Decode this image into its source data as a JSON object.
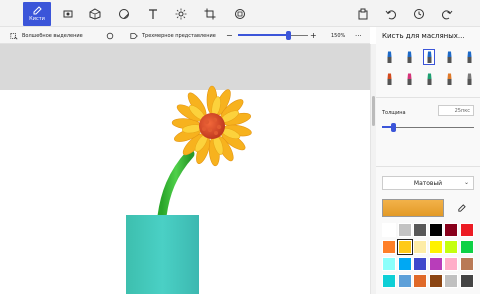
{
  "toolbar": {
    "brushes_label": "Кисти",
    "tools": [
      {
        "name": "2d-shapes-icon"
      },
      {
        "name": "3d-shapes-icon"
      },
      {
        "name": "stickers-icon"
      },
      {
        "name": "text-icon"
      },
      {
        "name": "effects-icon"
      },
      {
        "name": "canvas-icon"
      },
      {
        "name": "3d-library-icon"
      }
    ],
    "right_tools": [
      {
        "name": "paste-icon"
      },
      {
        "name": "undo-icon"
      },
      {
        "name": "history-icon"
      },
      {
        "name": "redo-icon"
      }
    ],
    "accent": "#3b55d9"
  },
  "subbar": {
    "magic_select": "Волшебное выделение",
    "view_3d": "Трехмерное представление",
    "zoom_value": "150%",
    "zoom_fraction": 0.72
  },
  "panel": {
    "title": "Кисть для масляных...",
    "brushes": [
      {
        "name": "marker-brush",
        "color": "#1e6ac8"
      },
      {
        "name": "calligraphy-pen",
        "color": "#1e6ac8"
      },
      {
        "name": "oil-brush",
        "color": "#1e6ac8",
        "selected": true
      },
      {
        "name": "watercolor-brush",
        "color": "#1e6ac8"
      },
      {
        "name": "pixel-pen",
        "color": "#1e6ac8"
      },
      {
        "name": "pencil",
        "color": "#d34a1e"
      },
      {
        "name": "eraser",
        "color": "#d5347a"
      },
      {
        "name": "crayon",
        "color": "#1ea072"
      },
      {
        "name": "spray-can",
        "color": "#e07a2a"
      },
      {
        "name": "fill",
        "color": "#7a7a7a"
      }
    ],
    "thickness_label": "Толщина",
    "thickness_value": "25пкс",
    "thickness_fraction": 0.12,
    "finish": "Матовый",
    "current_color": "#e39a26",
    "palette": [
      "#ffffff",
      "#c3c3c3",
      "#585858",
      "#000000",
      "#88001b",
      "#ec1c24",
      "#ff7f27",
      "#ffca18",
      "#fdeca6",
      "#fff200",
      "#c4ff0e",
      "#0ed145",
      "#8cfffb",
      "#00a8f3",
      "#3f48cc",
      "#b83dba",
      "#ffaec8",
      "#b97a56",
      "#0ecfd6",
      "#5ea0d9",
      "#e06a2a",
      "#8b4513",
      "#c0c0c0",
      "#444444"
    ]
  }
}
